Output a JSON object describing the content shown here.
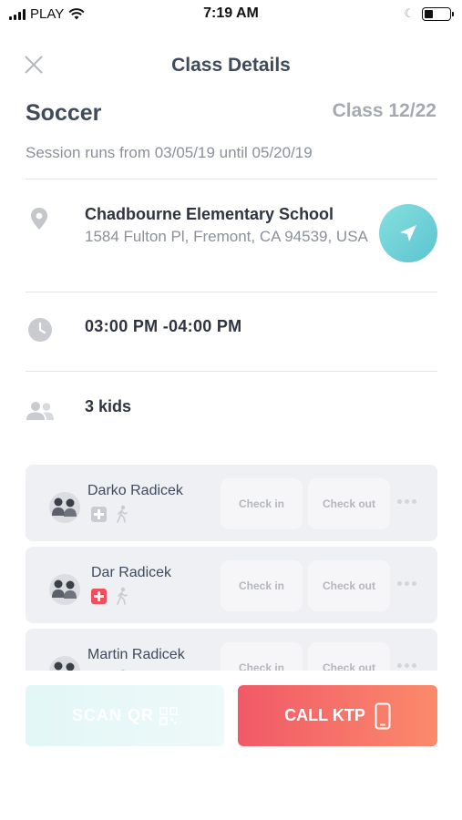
{
  "status_bar": {
    "carrier": "PLAY",
    "time": "7:19 AM"
  },
  "header": {
    "title": "Class Details",
    "close_icon": "close-icon"
  },
  "class_info": {
    "name": "Soccer",
    "count": "Class 12/22",
    "session": "Session runs from 03/05/19 until 05/20/19"
  },
  "location": {
    "icon": "location-pin-icon",
    "name": "Chadbourne Elementary School",
    "address": "1584 Fulton Pl, Fremont, CA 94539, USA",
    "navigate_icon": "navigation-arrow-icon"
  },
  "schedule": {
    "icon": "clock-icon",
    "time": "03:00 PM -04:00 PM"
  },
  "kids_summary": {
    "icon": "people-icon",
    "label": "3 kids"
  },
  "kids": [
    {
      "name": "Darko Radicek",
      "medical_alert": false,
      "check_in_label": "Check in",
      "check_out_label": "Check out"
    },
    {
      "name": "Dar  Radicek",
      "medical_alert": true,
      "check_in_label": "Check in",
      "check_out_label": "Check out"
    },
    {
      "name": "Martin Radicek",
      "medical_alert": true,
      "check_in_label": "Check in",
      "check_out_label": "Check out"
    }
  ],
  "footer": {
    "scan_label": "SCAN QR",
    "call_label": "CALL KTP",
    "scan_color": "#e2f7f6",
    "call_color": "#f15967"
  }
}
